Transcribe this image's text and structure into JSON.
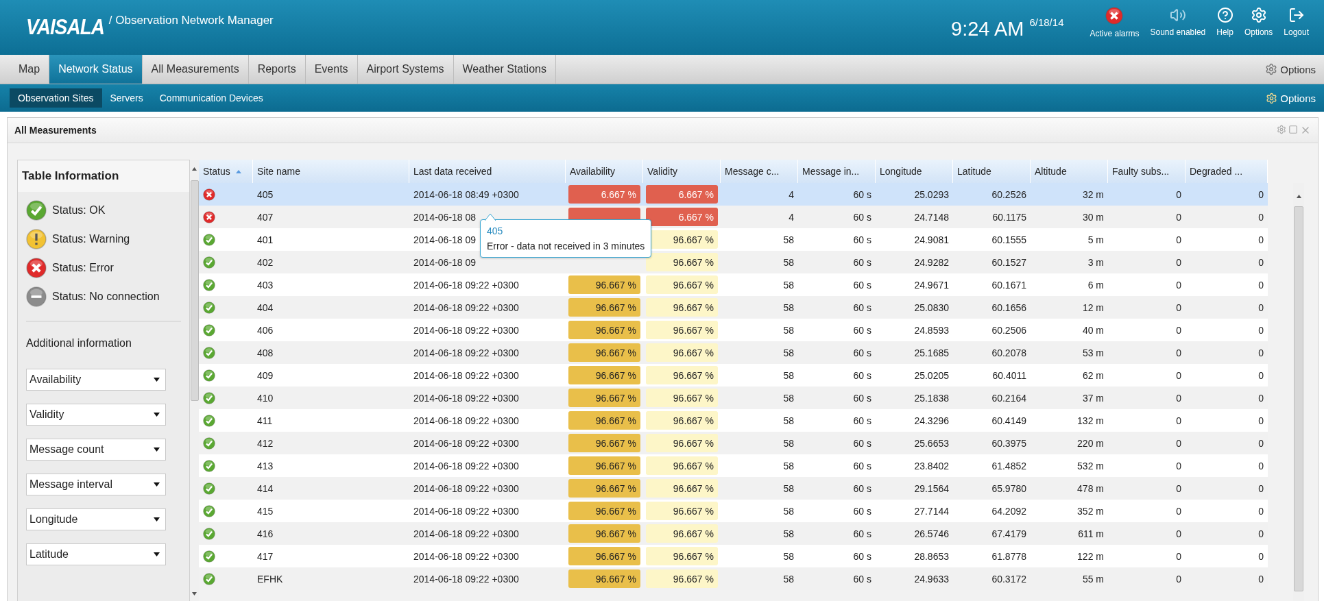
{
  "header": {
    "logo": "VAISALA",
    "app_title": "/ Observation Network Manager",
    "time": "9:24 AM",
    "date": "6/18/14",
    "actions": [
      {
        "kind": "alarm",
        "label": "Active alarms"
      },
      {
        "kind": "sound",
        "label": "Sound enabled"
      },
      {
        "kind": "help",
        "label": "Help"
      },
      {
        "kind": "options",
        "label": "Options"
      },
      {
        "kind": "logout",
        "label": "Logout"
      }
    ]
  },
  "tabs": [
    {
      "label": "Map",
      "selected": false
    },
    {
      "label": "Network Status",
      "selected": true
    },
    {
      "label": "All Measurements",
      "selected": false
    },
    {
      "label": "Reports",
      "selected": false
    },
    {
      "label": "Events",
      "selected": false
    },
    {
      "label": "Airport Systems",
      "selected": false
    },
    {
      "label": "Weather Stations",
      "selected": false
    }
  ],
  "tabs_options": "Options",
  "subtabs": [
    {
      "label": "Observation Sites",
      "selected": true
    },
    {
      "label": "Servers",
      "selected": false
    },
    {
      "label": "Communication Devices",
      "selected": false
    }
  ],
  "subtabs_options": "Options",
  "panel": {
    "title": "All Measurements",
    "table_info": {
      "title": "Table Information",
      "legend": [
        {
          "kind": "ok",
          "label": "Status: OK"
        },
        {
          "kind": "warning",
          "label": "Status: Warning"
        },
        {
          "kind": "error",
          "label": "Status: Error"
        },
        {
          "kind": "none",
          "label": "Status: No connection"
        }
      ],
      "additional_title": "Additional information",
      "selects": [
        "Availability",
        "Validity",
        "Message count",
        "Message interval",
        "Longitude",
        "Latitude"
      ]
    },
    "tooltip": {
      "title": "405",
      "text": "Error - data not received in 3 minutes"
    },
    "columns": [
      {
        "label": "Status",
        "sorted": true
      },
      {
        "label": "Site name",
        "sorted": false
      },
      {
        "label": "Last data received",
        "sorted": false
      },
      {
        "label": "Availability",
        "sorted": false
      },
      {
        "label": "Validity",
        "sorted": false
      },
      {
        "label": "Message c...",
        "sorted": false
      },
      {
        "label": "Message in...",
        "sorted": false
      },
      {
        "label": "Longitude",
        "sorted": false
      },
      {
        "label": "Latitude",
        "sorted": false
      },
      {
        "label": "Altitude",
        "sorted": false
      },
      {
        "label": "Faulty subs...",
        "sorted": false
      },
      {
        "label": "Degraded ...",
        "sorted": false
      }
    ],
    "rows": [
      {
        "kind": "error",
        "selected": true,
        "site": "405",
        "last": "2014-06-18 08:49 +0300",
        "availability": {
          "kind": "error",
          "text": "6.667 %"
        },
        "validity": {
          "kind": "error",
          "text": "6.667 %"
        },
        "count": "4",
        "interval": "60 s",
        "longitude": "25.0293",
        "latitude": "60.2526",
        "altitude": "32 m",
        "faulty": "0",
        "degraded": "0"
      },
      {
        "kind": "error",
        "selected": false,
        "site": "407",
        "last": "2014-06-18 08",
        "availability": {
          "kind": "error"
        },
        "validity": {
          "kind": "error",
          "text": "6.667 %"
        },
        "count": "4",
        "interval": "60 s",
        "longitude": "24.7148",
        "latitude": "60.1175",
        "altitude": "30 m",
        "faulty": "0",
        "degraded": "0"
      },
      {
        "kind": "ok",
        "selected": false,
        "site": "401",
        "last": "2014-06-18 09",
        "validity": {
          "kind": "normal",
          "text": "96.667 %"
        },
        "count": "58",
        "interval": "60 s",
        "longitude": "24.9081",
        "latitude": "60.1555",
        "altitude": "5 m",
        "faulty": "0",
        "degraded": "0"
      },
      {
        "kind": "ok",
        "selected": false,
        "site": "402",
        "last": "2014-06-18 09",
        "validity": {
          "kind": "normal",
          "text": "96.667 %"
        },
        "count": "58",
        "interval": "60 s",
        "longitude": "24.9282",
        "latitude": "60.1527",
        "altitude": "3 m",
        "faulty": "0",
        "degraded": "0"
      },
      {
        "kind": "ok",
        "selected": false,
        "site": "403",
        "last": "2014-06-18 09:22 +0300",
        "availability": {
          "kind": "warning",
          "text": "96.667 %"
        },
        "validity": {
          "kind": "normal",
          "text": "96.667 %"
        },
        "count": "58",
        "interval": "60 s",
        "longitude": "24.9671",
        "latitude": "60.1671",
        "altitude": "6 m",
        "faulty": "0",
        "degraded": "0"
      },
      {
        "kind": "ok",
        "selected": false,
        "site": "404",
        "last": "2014-06-18 09:22 +0300",
        "availability": {
          "kind": "warning",
          "text": "96.667 %"
        },
        "validity": {
          "kind": "normal",
          "text": "96.667 %"
        },
        "count": "58",
        "interval": "60 s",
        "longitude": "25.0830",
        "latitude": "60.1656",
        "altitude": "12 m",
        "faulty": "0",
        "degraded": "0"
      },
      {
        "kind": "ok",
        "selected": false,
        "site": "406",
        "last": "2014-06-18 09:22 +0300",
        "availability": {
          "kind": "warning",
          "text": "96.667 %"
        },
        "validity": {
          "kind": "normal",
          "text": "96.667 %"
        },
        "count": "58",
        "interval": "60 s",
        "longitude": "24.8593",
        "latitude": "60.2506",
        "altitude": "40 m",
        "faulty": "0",
        "degraded": "0"
      },
      {
        "kind": "ok",
        "selected": false,
        "site": "408",
        "last": "2014-06-18 09:22 +0300",
        "availability": {
          "kind": "warning",
          "text": "96.667 %"
        },
        "validity": {
          "kind": "normal",
          "text": "96.667 %"
        },
        "count": "58",
        "interval": "60 s",
        "longitude": "25.1685",
        "latitude": "60.2078",
        "altitude": "53 m",
        "faulty": "0",
        "degraded": "0"
      },
      {
        "kind": "ok",
        "selected": false,
        "site": "409",
        "last": "2014-06-18 09:22 +0300",
        "availability": {
          "kind": "warning",
          "text": "96.667 %"
        },
        "validity": {
          "kind": "normal",
          "text": "96.667 %"
        },
        "count": "58",
        "interval": "60 s",
        "longitude": "25.0205",
        "latitude": "60.4011",
        "altitude": "62 m",
        "faulty": "0",
        "degraded": "0"
      },
      {
        "kind": "ok",
        "selected": false,
        "site": "410",
        "last": "2014-06-18 09:22 +0300",
        "availability": {
          "kind": "warning",
          "text": "96.667 %"
        },
        "validity": {
          "kind": "normal",
          "text": "96.667 %"
        },
        "count": "58",
        "interval": "60 s",
        "longitude": "25.1838",
        "latitude": "60.2164",
        "altitude": "37 m",
        "faulty": "0",
        "degraded": "0"
      },
      {
        "kind": "ok",
        "selected": false,
        "site": "411",
        "last": "2014-06-18 09:22 +0300",
        "availability": {
          "kind": "warning",
          "text": "96.667 %"
        },
        "validity": {
          "kind": "normal",
          "text": "96.667 %"
        },
        "count": "58",
        "interval": "60 s",
        "longitude": "24.3296",
        "latitude": "60.4149",
        "altitude": "132 m",
        "faulty": "0",
        "degraded": "0"
      },
      {
        "kind": "ok",
        "selected": false,
        "site": "412",
        "last": "2014-06-18 09:22 +0300",
        "availability": {
          "kind": "warning",
          "text": "96.667 %"
        },
        "validity": {
          "kind": "normal",
          "text": "96.667 %"
        },
        "count": "58",
        "interval": "60 s",
        "longitude": "25.6653",
        "latitude": "60.3975",
        "altitude": "220 m",
        "faulty": "0",
        "degraded": "0"
      },
      {
        "kind": "ok",
        "selected": false,
        "site": "413",
        "last": "2014-06-18 09:22 +0300",
        "availability": {
          "kind": "warning",
          "text": "96.667 %"
        },
        "validity": {
          "kind": "normal",
          "text": "96.667 %"
        },
        "count": "58",
        "interval": "60 s",
        "longitude": "23.8402",
        "latitude": "61.4852",
        "altitude": "532 m",
        "faulty": "0",
        "degraded": "0"
      },
      {
        "kind": "ok",
        "selected": false,
        "site": "414",
        "last": "2014-06-18 09:22 +0300",
        "availability": {
          "kind": "warning",
          "text": "96.667 %"
        },
        "validity": {
          "kind": "normal",
          "text": "96.667 %"
        },
        "count": "58",
        "interval": "60 s",
        "longitude": "29.1564",
        "latitude": "65.9780",
        "altitude": "478 m",
        "faulty": "0",
        "degraded": "0"
      },
      {
        "kind": "ok",
        "selected": false,
        "site": "415",
        "last": "2014-06-18 09:22 +0300",
        "availability": {
          "kind": "warning",
          "text": "96.667 %"
        },
        "validity": {
          "kind": "normal",
          "text": "96.667 %"
        },
        "count": "58",
        "interval": "60 s",
        "longitude": "27.7144",
        "latitude": "64.2092",
        "altitude": "352 m",
        "faulty": "0",
        "degraded": "0"
      },
      {
        "kind": "ok",
        "selected": false,
        "site": "416",
        "last": "2014-06-18 09:22 +0300",
        "availability": {
          "kind": "warning",
          "text": "96.667 %"
        },
        "validity": {
          "kind": "normal",
          "text": "96.667 %"
        },
        "count": "58",
        "interval": "60 s",
        "longitude": "26.5746",
        "latitude": "67.4179",
        "altitude": "611 m",
        "faulty": "0",
        "degraded": "0"
      },
      {
        "kind": "ok",
        "selected": false,
        "site": "417",
        "last": "2014-06-18 09:22 +0300",
        "availability": {
          "kind": "warning",
          "text": "96.667 %"
        },
        "validity": {
          "kind": "normal",
          "text": "96.667 %"
        },
        "count": "58",
        "interval": "60 s",
        "longitude": "28.8653",
        "latitude": "61.8778",
        "altitude": "122 m",
        "faulty": "0",
        "degraded": "0"
      },
      {
        "kind": "ok",
        "selected": false,
        "site": "EFHK",
        "last": "2014-06-18 09:22 +0300",
        "availability": {
          "kind": "warning",
          "text": "96.667 %"
        },
        "validity": {
          "kind": "normal",
          "text": "96.667 %"
        },
        "count": "58",
        "interval": "60 s",
        "longitude": "24.9633",
        "latitude": "60.3172",
        "altitude": "55 m",
        "faulty": "0",
        "degraded": "0"
      }
    ]
  }
}
